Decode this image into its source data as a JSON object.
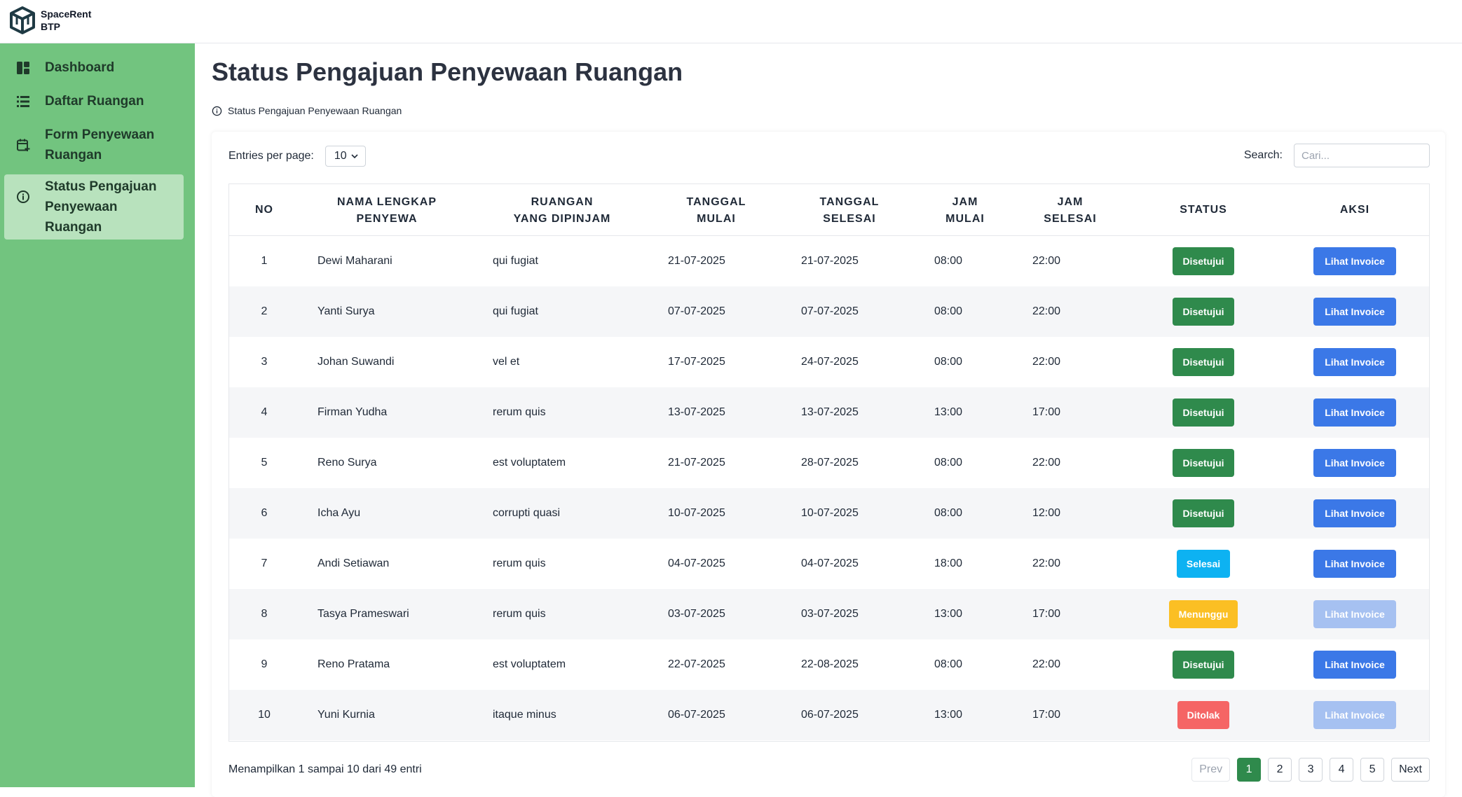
{
  "app": {
    "logo_line1": "SpaceRent",
    "logo_line2": "BTP"
  },
  "sidebar": {
    "items": [
      {
        "label": "Dashboard",
        "icon": "dashboard-icon",
        "active": false
      },
      {
        "label": "Daftar Ruangan",
        "icon": "list-icon",
        "active": false
      },
      {
        "label": "Form Penyewaan Ruangan",
        "icon": "calendar-add-icon",
        "active": false
      },
      {
        "label": "Status Pengajuan Penyewaan Ruangan",
        "icon": "info-circle-icon",
        "active": true
      }
    ]
  },
  "page": {
    "title": "Status Pengajuan Penyewaan Ruangan",
    "breadcrumb": "Status Pengajuan Penyewaan Ruangan"
  },
  "controls": {
    "entries_label": "Entries per page:",
    "entries_value": "10",
    "search_label": "Search:",
    "search_placeholder": "Cari..."
  },
  "table": {
    "headers": [
      "NO",
      "NAMA LENGKAP\nPENYEWA",
      "RUANGAN\nYANG DIPINJAM",
      "TANGGAL\nMULAI",
      "TANGGAL\nSELESAI",
      "JAM\nMULAI",
      "JAM\nSELESAI",
      "STATUS",
      "AKSI"
    ],
    "rows": [
      {
        "no": "1",
        "nama": "Dewi Maharani",
        "ruangan": "qui fugiat",
        "tgl_mulai": "21-07-2025",
        "tgl_selesai": "21-07-2025",
        "jam_mulai": "08:00",
        "jam_selesai": "22:00",
        "status": "Disetujui",
        "aksi": "Lihat Invoice",
        "aksi_enabled": true
      },
      {
        "no": "2",
        "nama": "Yanti Surya",
        "ruangan": "qui fugiat",
        "tgl_mulai": "07-07-2025",
        "tgl_selesai": "07-07-2025",
        "jam_mulai": "08:00",
        "jam_selesai": "22:00",
        "status": "Disetujui",
        "aksi": "Lihat Invoice",
        "aksi_enabled": true
      },
      {
        "no": "3",
        "nama": "Johan Suwandi",
        "ruangan": "vel et",
        "tgl_mulai": "17-07-2025",
        "tgl_selesai": "24-07-2025",
        "jam_mulai": "08:00",
        "jam_selesai": "22:00",
        "status": "Disetujui",
        "aksi": "Lihat Invoice",
        "aksi_enabled": true
      },
      {
        "no": "4",
        "nama": "Firman Yudha",
        "ruangan": "rerum quis",
        "tgl_mulai": "13-07-2025",
        "tgl_selesai": "13-07-2025",
        "jam_mulai": "13:00",
        "jam_selesai": "17:00",
        "status": "Disetujui",
        "aksi": "Lihat Invoice",
        "aksi_enabled": true
      },
      {
        "no": "5",
        "nama": "Reno Surya",
        "ruangan": "est voluptatem",
        "tgl_mulai": "21-07-2025",
        "tgl_selesai": "28-07-2025",
        "jam_mulai": "08:00",
        "jam_selesai": "22:00",
        "status": "Disetujui",
        "aksi": "Lihat Invoice",
        "aksi_enabled": true
      },
      {
        "no": "6",
        "nama": "Icha Ayu",
        "ruangan": "corrupti quasi",
        "tgl_mulai": "10-07-2025",
        "tgl_selesai": "10-07-2025",
        "jam_mulai": "08:00",
        "jam_selesai": "12:00",
        "status": "Disetujui",
        "aksi": "Lihat Invoice",
        "aksi_enabled": true
      },
      {
        "no": "7",
        "nama": "Andi Setiawan",
        "ruangan": "rerum quis",
        "tgl_mulai": "04-07-2025",
        "tgl_selesai": "04-07-2025",
        "jam_mulai": "18:00",
        "jam_selesai": "22:00",
        "status": "Selesai",
        "aksi": "Lihat Invoice",
        "aksi_enabled": true
      },
      {
        "no": "8",
        "nama": "Tasya Prameswari",
        "ruangan": "rerum quis",
        "tgl_mulai": "03-07-2025",
        "tgl_selesai": "03-07-2025",
        "jam_mulai": "13:00",
        "jam_selesai": "17:00",
        "status": "Menunggu",
        "aksi": "Lihat Invoice",
        "aksi_enabled": false
      },
      {
        "no": "9",
        "nama": "Reno Pratama",
        "ruangan": "est voluptatem",
        "tgl_mulai": "22-07-2025",
        "tgl_selesai": "22-08-2025",
        "jam_mulai": "08:00",
        "jam_selesai": "22:00",
        "status": "Disetujui",
        "aksi": "Lihat Invoice",
        "aksi_enabled": true
      },
      {
        "no": "10",
        "nama": "Yuni Kurnia",
        "ruangan": "itaque minus",
        "tgl_mulai": "06-07-2025",
        "tgl_selesai": "06-07-2025",
        "jam_mulai": "13:00",
        "jam_selesai": "17:00",
        "status": "Ditolak",
        "aksi": "Lihat Invoice",
        "aksi_enabled": false
      }
    ]
  },
  "status_colors": {
    "Disetujui": "#2f8a4c",
    "Selesai": "#0db2f2",
    "Menunggu": "#fbbf24",
    "Ditolak": "#f56565"
  },
  "footer": {
    "info": "Menampilkan 1 sampai 10 dari 49 entri",
    "prev": "Prev",
    "pages": [
      "1",
      "2",
      "3",
      "4",
      "5"
    ],
    "current_page": "1",
    "next": "Next"
  }
}
